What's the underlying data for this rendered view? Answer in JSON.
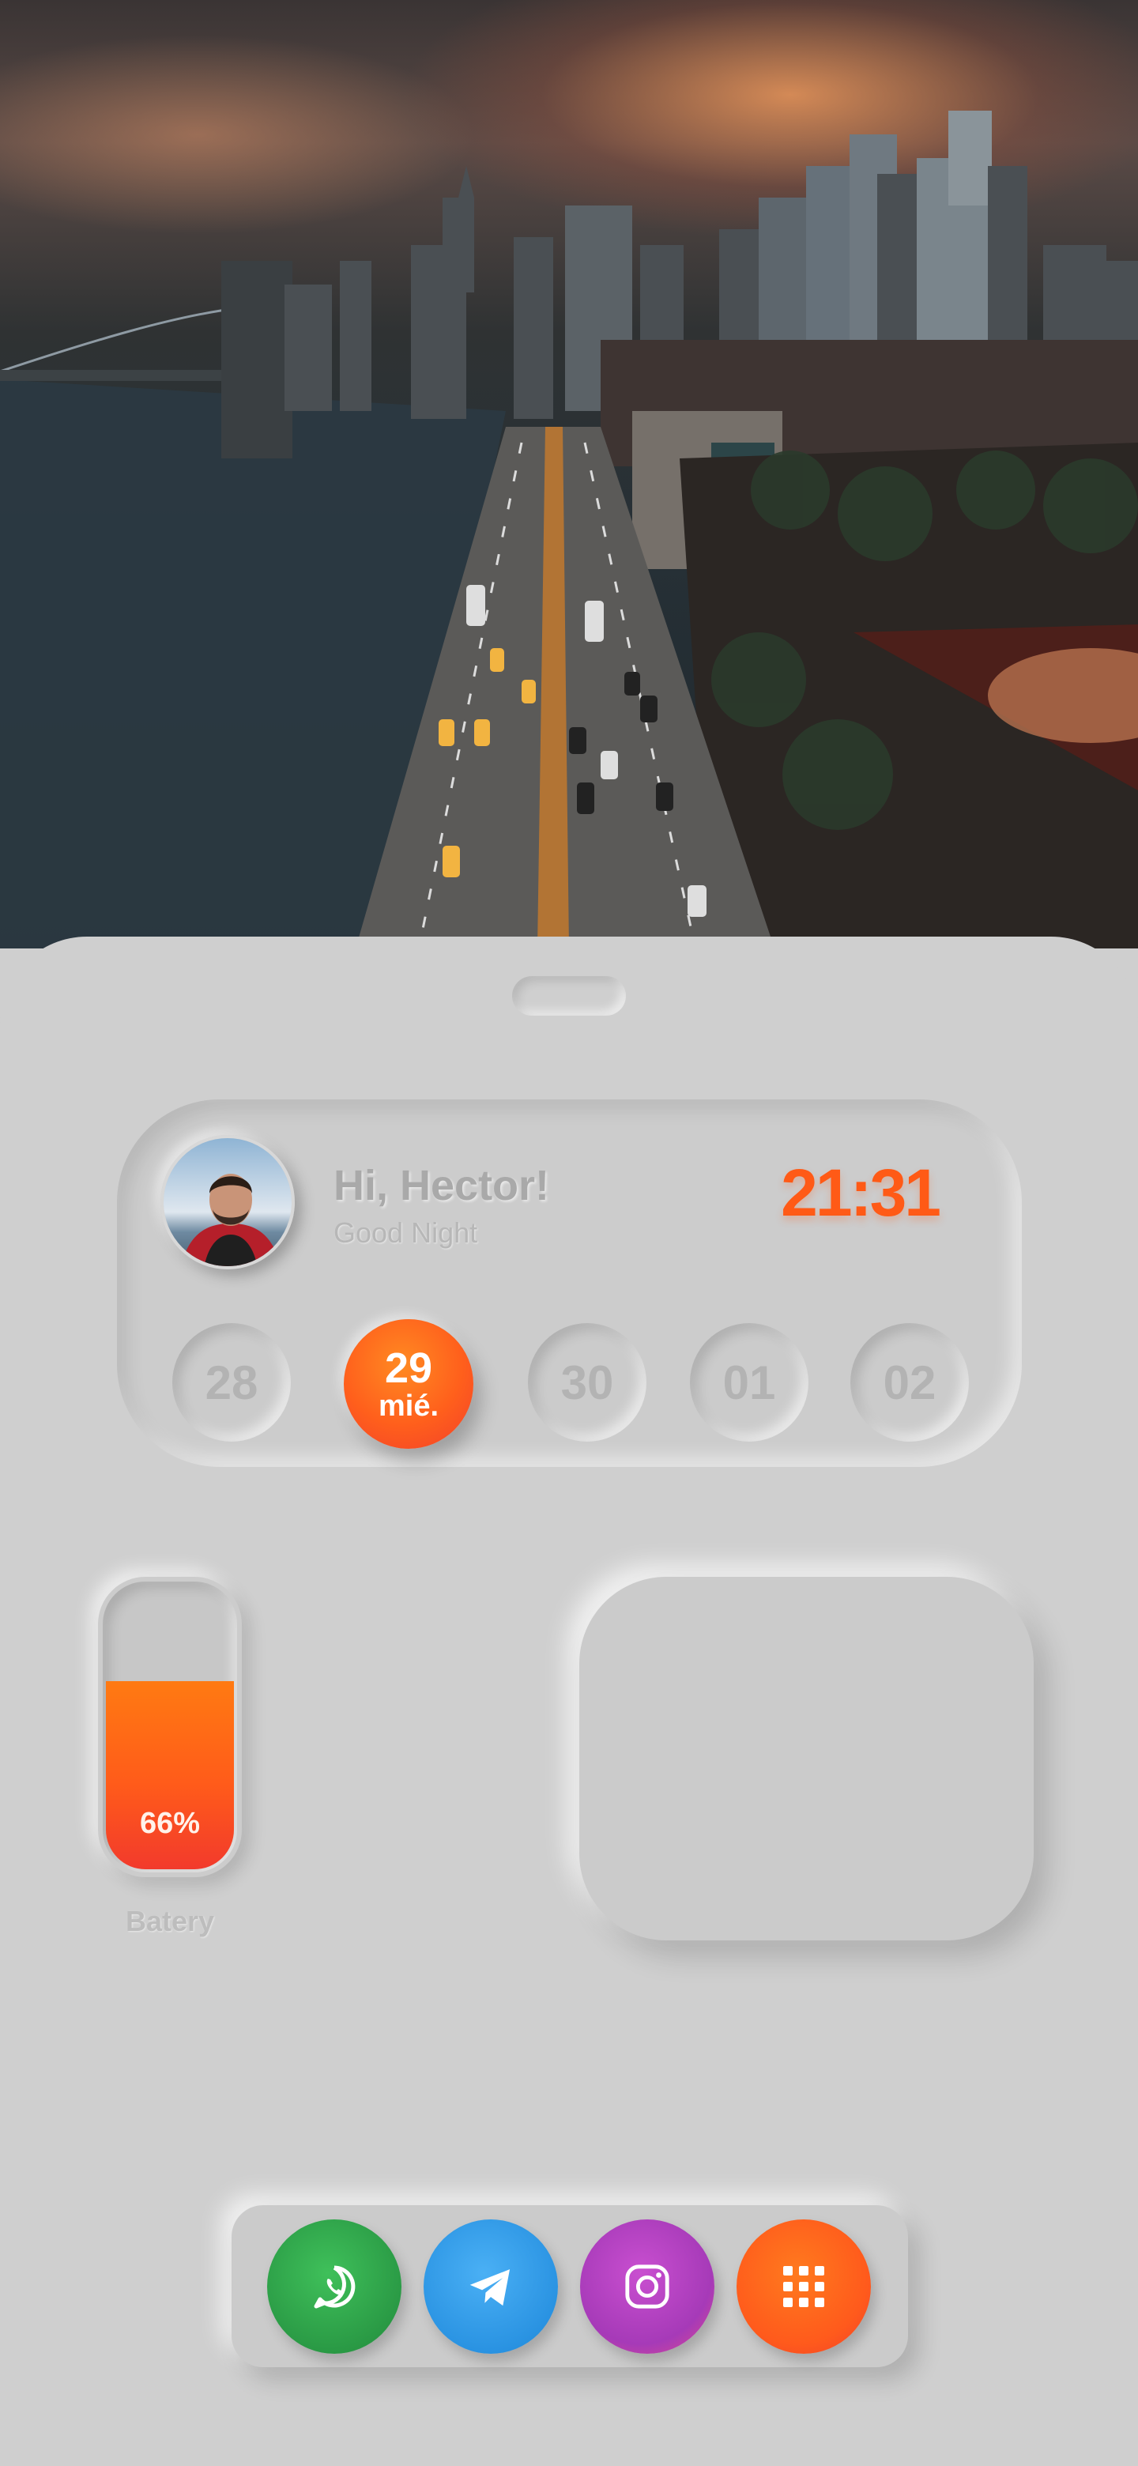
{
  "header": {
    "greeting": "Hi, Hector!",
    "subtitle": "Good Night",
    "time": "21:31"
  },
  "dates": [
    {
      "day": "28",
      "weekday": "",
      "active": false
    },
    {
      "day": "29",
      "weekday": "mié.",
      "active": true
    },
    {
      "day": "30",
      "weekday": "",
      "active": false
    },
    {
      "day": "01",
      "weekday": "",
      "active": false
    },
    {
      "day": "02",
      "weekday": "",
      "active": false
    }
  ],
  "battery": {
    "percent_text": "66%",
    "level": 0.66,
    "label": "Batery"
  },
  "dock": {
    "apps": [
      {
        "name": "WhatsApp",
        "icon": "whatsapp-icon",
        "color": "#2ea84a"
      },
      {
        "name": "Telegram",
        "icon": "telegram-icon",
        "color": "#2a9ae6"
      },
      {
        "name": "Instagram",
        "icon": "instagram-icon",
        "color": "#b03fc0"
      },
      {
        "name": "App drawer",
        "icon": "grid-icon",
        "color": "#ff5a1c"
      }
    ]
  },
  "colors": {
    "accent": "#ff5a16",
    "panel": "#cfcfcf"
  }
}
